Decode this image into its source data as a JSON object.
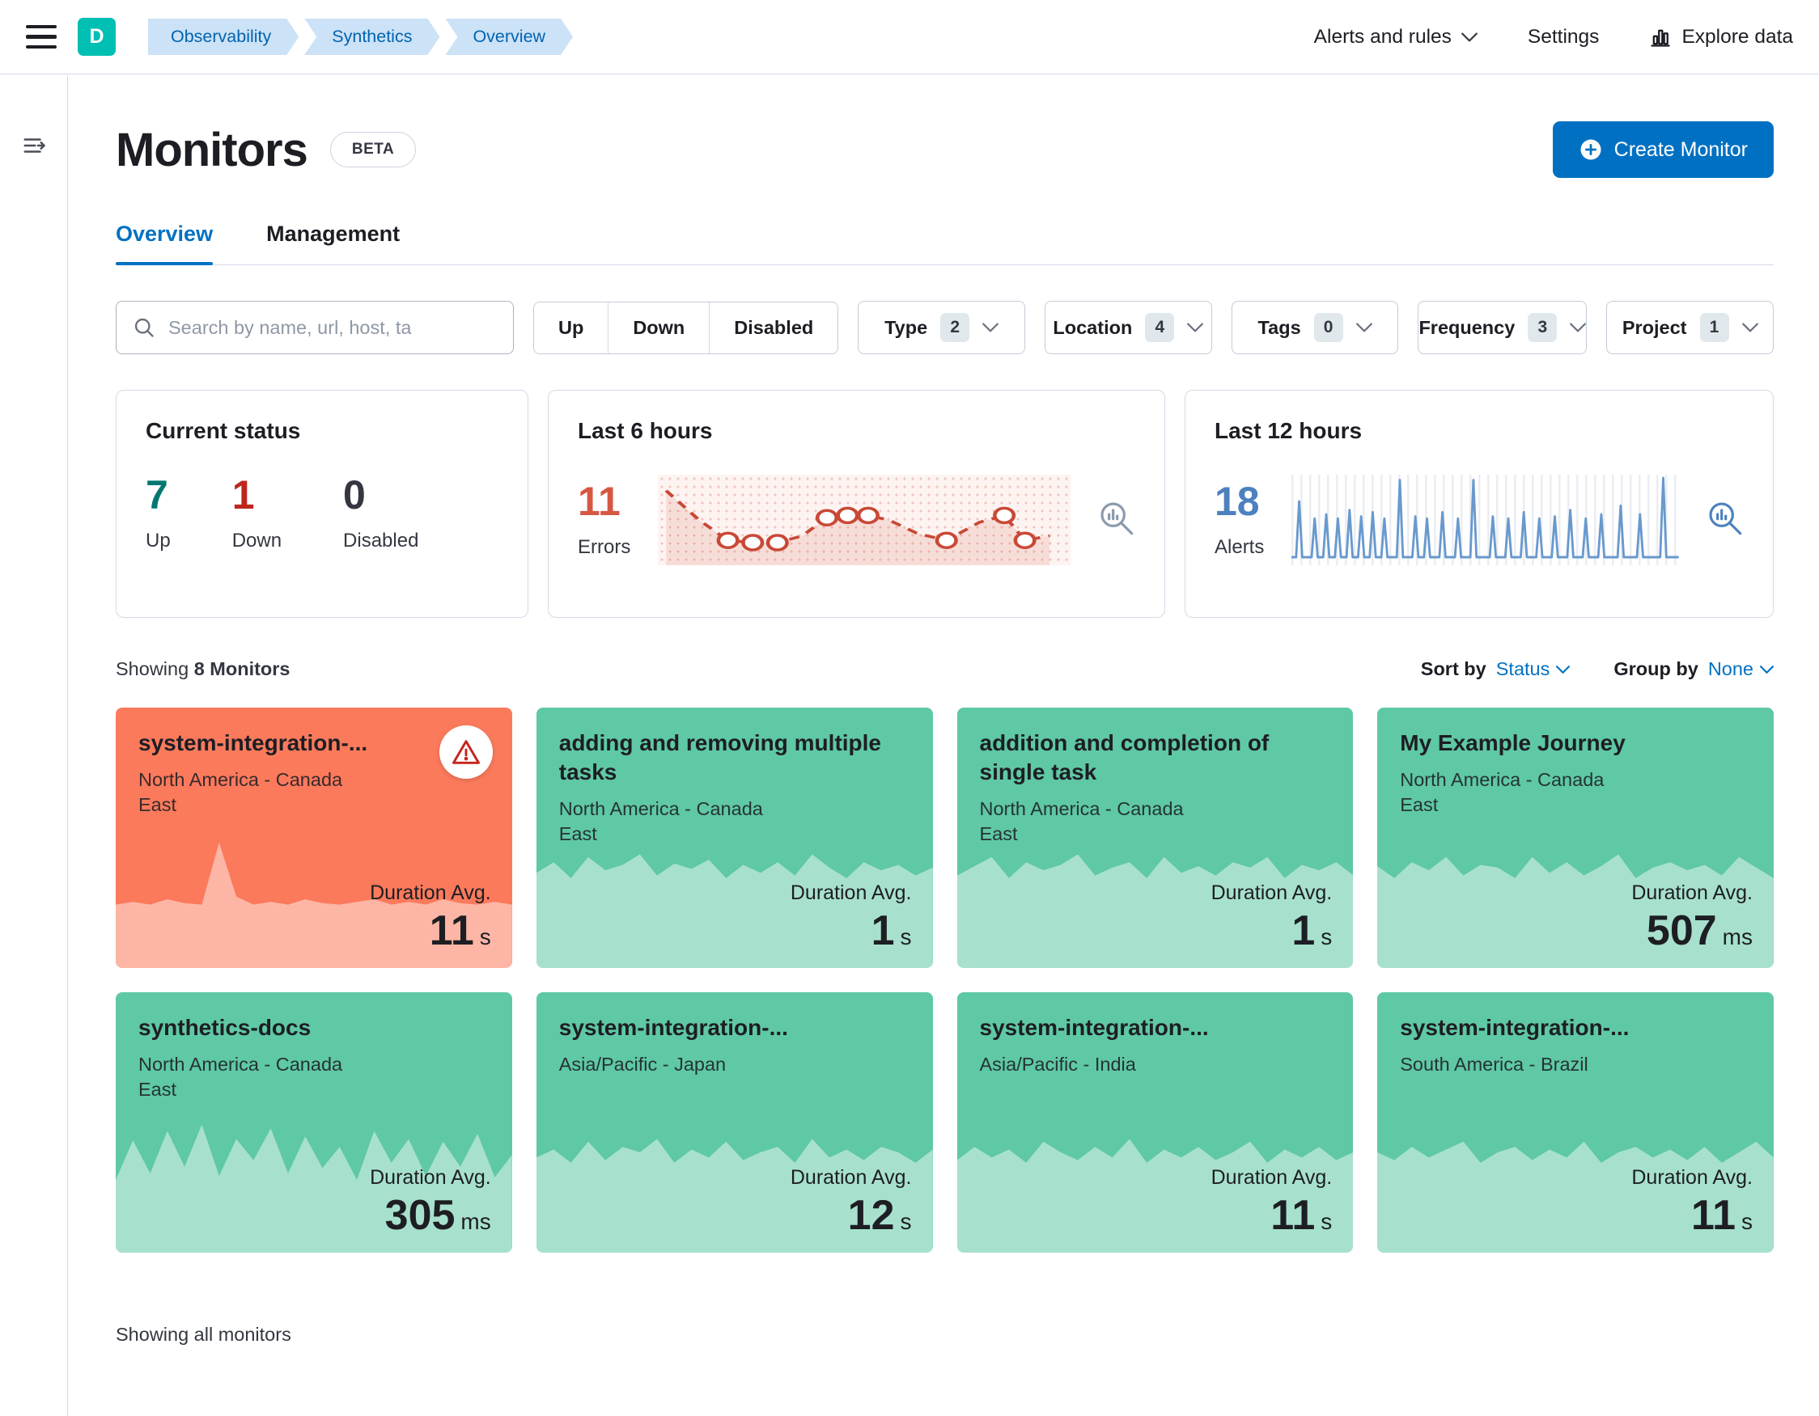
{
  "colors": {
    "primary": "#0071C2",
    "avatar_teal": "#00BFB3",
    "breadcrumb_bg": "#CCE2F6",
    "green_card": "#5FC8A5",
    "red_card": "#FB7A5C",
    "up_green": "#007871",
    "down_red": "#BD271E",
    "errors_red": "#D65843",
    "alerts_blue": "#4C81BE"
  },
  "header": {
    "avatar_letter": "D",
    "breadcrumbs": [
      "Observability",
      "Synthetics",
      "Overview"
    ],
    "alerts_menu": "Alerts and rules",
    "settings": "Settings",
    "explore_data": "Explore data"
  },
  "page": {
    "title": "Monitors",
    "beta_badge": "BETA",
    "create_button": "Create Monitor",
    "tabs": [
      {
        "label": "Overview"
      },
      {
        "label": "Management"
      }
    ],
    "search_placeholder": "Search by name, url, host, ta",
    "status_filters": [
      "Up",
      "Down",
      "Disabled"
    ],
    "filters": [
      {
        "label": "Type",
        "count": "2"
      },
      {
        "label": "Location",
        "count": "4"
      },
      {
        "label": "Tags",
        "count": "0"
      },
      {
        "label": "Frequency",
        "count": "3"
      },
      {
        "label": "Project",
        "count": "1"
      }
    ]
  },
  "stats": {
    "current_status": {
      "title": "Current status",
      "items": [
        {
          "value": "7",
          "label": "Up"
        },
        {
          "value": "1",
          "label": "Down"
        },
        {
          "value": "0",
          "label": "Disabled"
        }
      ]
    },
    "last6": {
      "title": "Last 6 hours",
      "value": "11",
      "label": "Errors",
      "points": [
        {
          "x": 2,
          "y": 7,
          "c": 0
        },
        {
          "x": 10,
          "y": 20,
          "c": 0
        },
        {
          "x": 17,
          "y": 29,
          "c": 1
        },
        {
          "x": 23,
          "y": 30,
          "c": 1
        },
        {
          "x": 29,
          "y": 30,
          "c": 1
        },
        {
          "x": 35,
          "y": 27,
          "c": 0
        },
        {
          "x": 41,
          "y": 19,
          "c": 1
        },
        {
          "x": 46,
          "y": 18,
          "c": 1
        },
        {
          "x": 51,
          "y": 18,
          "c": 1
        },
        {
          "x": 56,
          "y": 20,
          "c": 0
        },
        {
          "x": 63,
          "y": 26,
          "c": 0
        },
        {
          "x": 70,
          "y": 29,
          "c": 1
        },
        {
          "x": 78,
          "y": 21,
          "c": 0
        },
        {
          "x": 84,
          "y": 18,
          "c": 1
        },
        {
          "x": 89,
          "y": 29,
          "c": 1
        },
        {
          "x": 95,
          "y": 27,
          "c": 0
        }
      ]
    },
    "last12": {
      "title": "Last 12 hours",
      "value": "18",
      "label": "Alerts",
      "spikes": [
        [
          2,
          26
        ],
        [
          6,
          18
        ],
        [
          9,
          20
        ],
        [
          12,
          18
        ],
        [
          15,
          22
        ],
        [
          18,
          19
        ],
        [
          21,
          21
        ],
        [
          24,
          18
        ],
        [
          28,
          36
        ],
        [
          32,
          19
        ],
        [
          35,
          18
        ],
        [
          39,
          21
        ],
        [
          43,
          18
        ],
        [
          47,
          36
        ],
        [
          52,
          19
        ],
        [
          56,
          18
        ],
        [
          60,
          21
        ],
        [
          64,
          18
        ],
        [
          68,
          19
        ],
        [
          72,
          22
        ],
        [
          76,
          18
        ],
        [
          80,
          20
        ],
        [
          85,
          24
        ],
        [
          90,
          20
        ],
        [
          96,
          37
        ]
      ]
    }
  },
  "list": {
    "showing_prefix": "Showing",
    "showing_count": "8 Monitors",
    "sort_label": "Sort by",
    "sort_value": "Status",
    "group_label": "Group by",
    "group_value": "None",
    "footer": "Showing all monitors"
  },
  "monitors": [
    {
      "name": "system-integration-...",
      "location": "North America - Canada East",
      "duration_label": "Duration Avg.",
      "duration": "11",
      "unit": "s",
      "status": "down",
      "spark": [
        48,
        50,
        48,
        52,
        49,
        48,
        95,
        54,
        48,
        50,
        48,
        52,
        49,
        48,
        50,
        52,
        48,
        50,
        48,
        52,
        49,
        48,
        50,
        48
      ]
    },
    {
      "name": "adding and removing multiple tasks",
      "location": "North America - Canada East",
      "duration_label": "Duration Avg.",
      "duration": "1",
      "unit": "s",
      "status": "up",
      "spark": [
        72,
        80,
        68,
        84,
        74,
        78,
        86,
        70,
        79,
        75,
        82,
        68,
        78,
        72,
        80,
        70,
        86,
        76,
        68,
        80,
        74,
        78,
        70,
        76
      ]
    },
    {
      "name": "addition and completion of single task",
      "location": "North America - Canada East",
      "duration_label": "Duration Avg.",
      "duration": "1",
      "unit": "s",
      "status": "up",
      "spark": [
        70,
        77,
        84,
        68,
        80,
        74,
        78,
        86,
        70,
        76,
        80,
        68,
        84,
        72,
        77,
        70,
        80,
        76,
        84,
        68,
        78,
        74,
        80,
        70
      ]
    },
    {
      "name": "My Example Journey",
      "location": "North America - Canada East",
      "duration_label": "Duration Avg.",
      "duration": "507",
      "unit": "ms",
      "status": "up",
      "spark": [
        77,
        68,
        80,
        74,
        84,
        70,
        78,
        76,
        68,
        84,
        72,
        80,
        70,
        77,
        86,
        68,
        76,
        80,
        74,
        78,
        70,
        84,
        76,
        68
      ]
    },
    {
      "name": "synthetics-docs",
      "location": "North America - Canada East",
      "duration_label": "Duration Avg.",
      "duration": "305",
      "unit": "ms",
      "status": "up",
      "spark": [
        55,
        85,
        60,
        92,
        65,
        97,
        58,
        86,
        70,
        94,
        60,
        88,
        64,
        80,
        55,
        92,
        68,
        86,
        58,
        84,
        65,
        90,
        57,
        74
      ]
    },
    {
      "name": "system-integration-...",
      "location": "Asia/Pacific - Japan",
      "duration_label": "Duration Avg.",
      "duration": "12",
      "unit": "s",
      "status": "up",
      "spark": [
        72,
        78,
        68,
        84,
        70,
        80,
        76,
        86,
        68,
        78,
        72,
        84,
        70,
        76,
        80,
        68,
        86,
        72,
        78,
        70,
        80,
        76,
        68,
        78
      ]
    },
    {
      "name": "system-integration-...",
      "location": "Asia/Pacific - India",
      "duration_label": "Duration Avg.",
      "duration": "11",
      "unit": "s",
      "status": "up",
      "spark": [
        70,
        80,
        72,
        78,
        68,
        84,
        76,
        70,
        80,
        72,
        86,
        68,
        78,
        72,
        80,
        70,
        76,
        84,
        68,
        78,
        72,
        80,
        70,
        76
      ]
    },
    {
      "name": "system-integration-...",
      "location": "South America - Brazil",
      "duration_label": "Duration Avg.",
      "duration": "11",
      "unit": "s",
      "status": "up",
      "spark": [
        76,
        70,
        80,
        72,
        78,
        84,
        68,
        76,
        80,
        70,
        78,
        72,
        84,
        68,
        76,
        80,
        72,
        78,
        70,
        80,
        68,
        76,
        84,
        72
      ]
    }
  ]
}
